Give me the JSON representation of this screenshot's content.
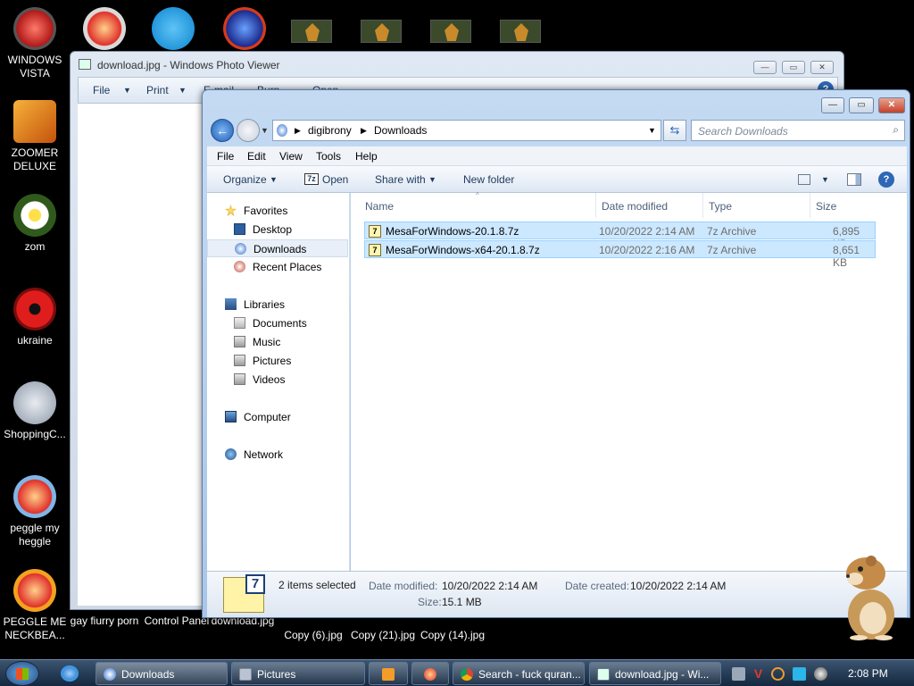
{
  "desktop": {
    "icons": [
      {
        "label": "WINDOWS VISTA"
      },
      {
        "label": "ZOOMER DELUXE"
      },
      {
        "label": "zom"
      },
      {
        "label": "ukraine"
      },
      {
        "label": "ShoppingC..."
      },
      {
        "label": "peggle my heggle"
      },
      {
        "label": "PEGGLE ME NECKBEA..."
      }
    ],
    "bottom_labels": [
      "gay fiurry porn",
      "Control Panel",
      "download.jpg",
      "Copy (6).jpg",
      "Copy (21).jpg",
      "Copy (14).jpg"
    ]
  },
  "photo_viewer": {
    "title": "download.jpg - Windows Photo Viewer",
    "menu": [
      "File",
      "Print",
      "E-mail",
      "Burn",
      "Open"
    ]
  },
  "explorer": {
    "breadcrumb": [
      "digibrony",
      "Downloads"
    ],
    "search_placeholder": "Search Downloads",
    "menubar": [
      "File",
      "Edit",
      "View",
      "Tools",
      "Help"
    ],
    "toolbar": {
      "organize": "Organize",
      "open": "Open",
      "share_with": "Share with",
      "new_folder": "New folder"
    },
    "nav": {
      "favorites": "Favorites",
      "desktop": "Desktop",
      "downloads": "Downloads",
      "recent_places": "Recent Places",
      "libraries": "Libraries",
      "documents": "Documents",
      "music": "Music",
      "pictures": "Pictures",
      "videos": "Videos",
      "computer": "Computer",
      "network": "Network"
    },
    "columns": {
      "name": "Name",
      "date_modified": "Date modified",
      "type": "Type",
      "size": "Size"
    },
    "files": [
      {
        "name": "MesaForWindows-20.1.8.7z",
        "date_modified": "10/20/2022 2:14 AM",
        "type": "7z Archive",
        "size": "6,895 KB"
      },
      {
        "name": "MesaForWindows-x64-20.1.8.7z",
        "date_modified": "10/20/2022 2:16 AM",
        "type": "7z Archive",
        "size": "8,651 KB"
      }
    ],
    "details": {
      "selection": "2 items selected",
      "date_modified_label": "Date modified:",
      "date_modified": "10/20/2022 2:14 AM",
      "date_created_label": "Date created:",
      "date_created": "10/20/2022 2:14 AM",
      "size_label": "Size:",
      "size": "15.1 MB"
    }
  },
  "taskbar": {
    "buttons": [
      {
        "label": "Downloads"
      },
      {
        "label": "Pictures"
      },
      {
        "label": ""
      },
      {
        "label": ""
      },
      {
        "label": "Search - fuck quran..."
      },
      {
        "label": "download.jpg - Wi..."
      }
    ],
    "clock": "2:08 PM"
  }
}
